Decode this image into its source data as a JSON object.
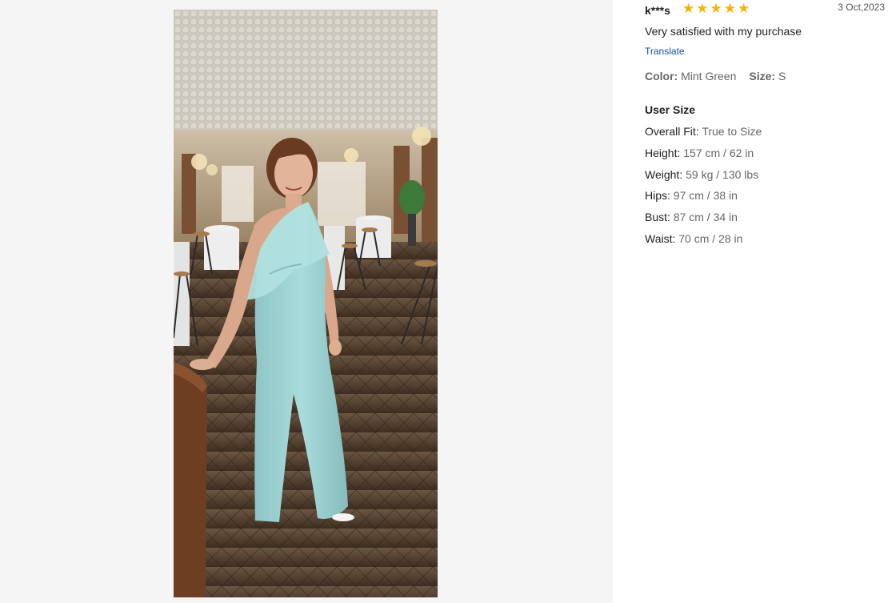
{
  "review": {
    "reviewer": "k***s",
    "rating": 5,
    "stars": [
      "★",
      "★",
      "★",
      "★",
      "★"
    ],
    "date": "3 Oct,2023",
    "text": "Very satisfied with my purchase",
    "translate_label": "Translate",
    "attributes": {
      "color_label": "Color:",
      "color_value": "Mint Green",
      "size_label": "Size:",
      "size_value": "S"
    },
    "user_size": {
      "title": "User Size",
      "rows": [
        {
          "label": "Overall Fit:",
          "value": "True to Size"
        },
        {
          "label": "Height:",
          "value": "157 cm / 62 in"
        },
        {
          "label": "Weight:",
          "value": "59 kg / 130 lbs"
        },
        {
          "label": "Hips:",
          "value": "97 cm / 38 in"
        },
        {
          "label": "Bust:",
          "value": "87 cm / 34 in"
        },
        {
          "label": "Waist:",
          "value": "70 cm / 28 in"
        }
      ]
    }
  },
  "colors": {
    "star": "#f5b301",
    "link": "#1a4fa0",
    "dress": "#9fd3d4"
  }
}
